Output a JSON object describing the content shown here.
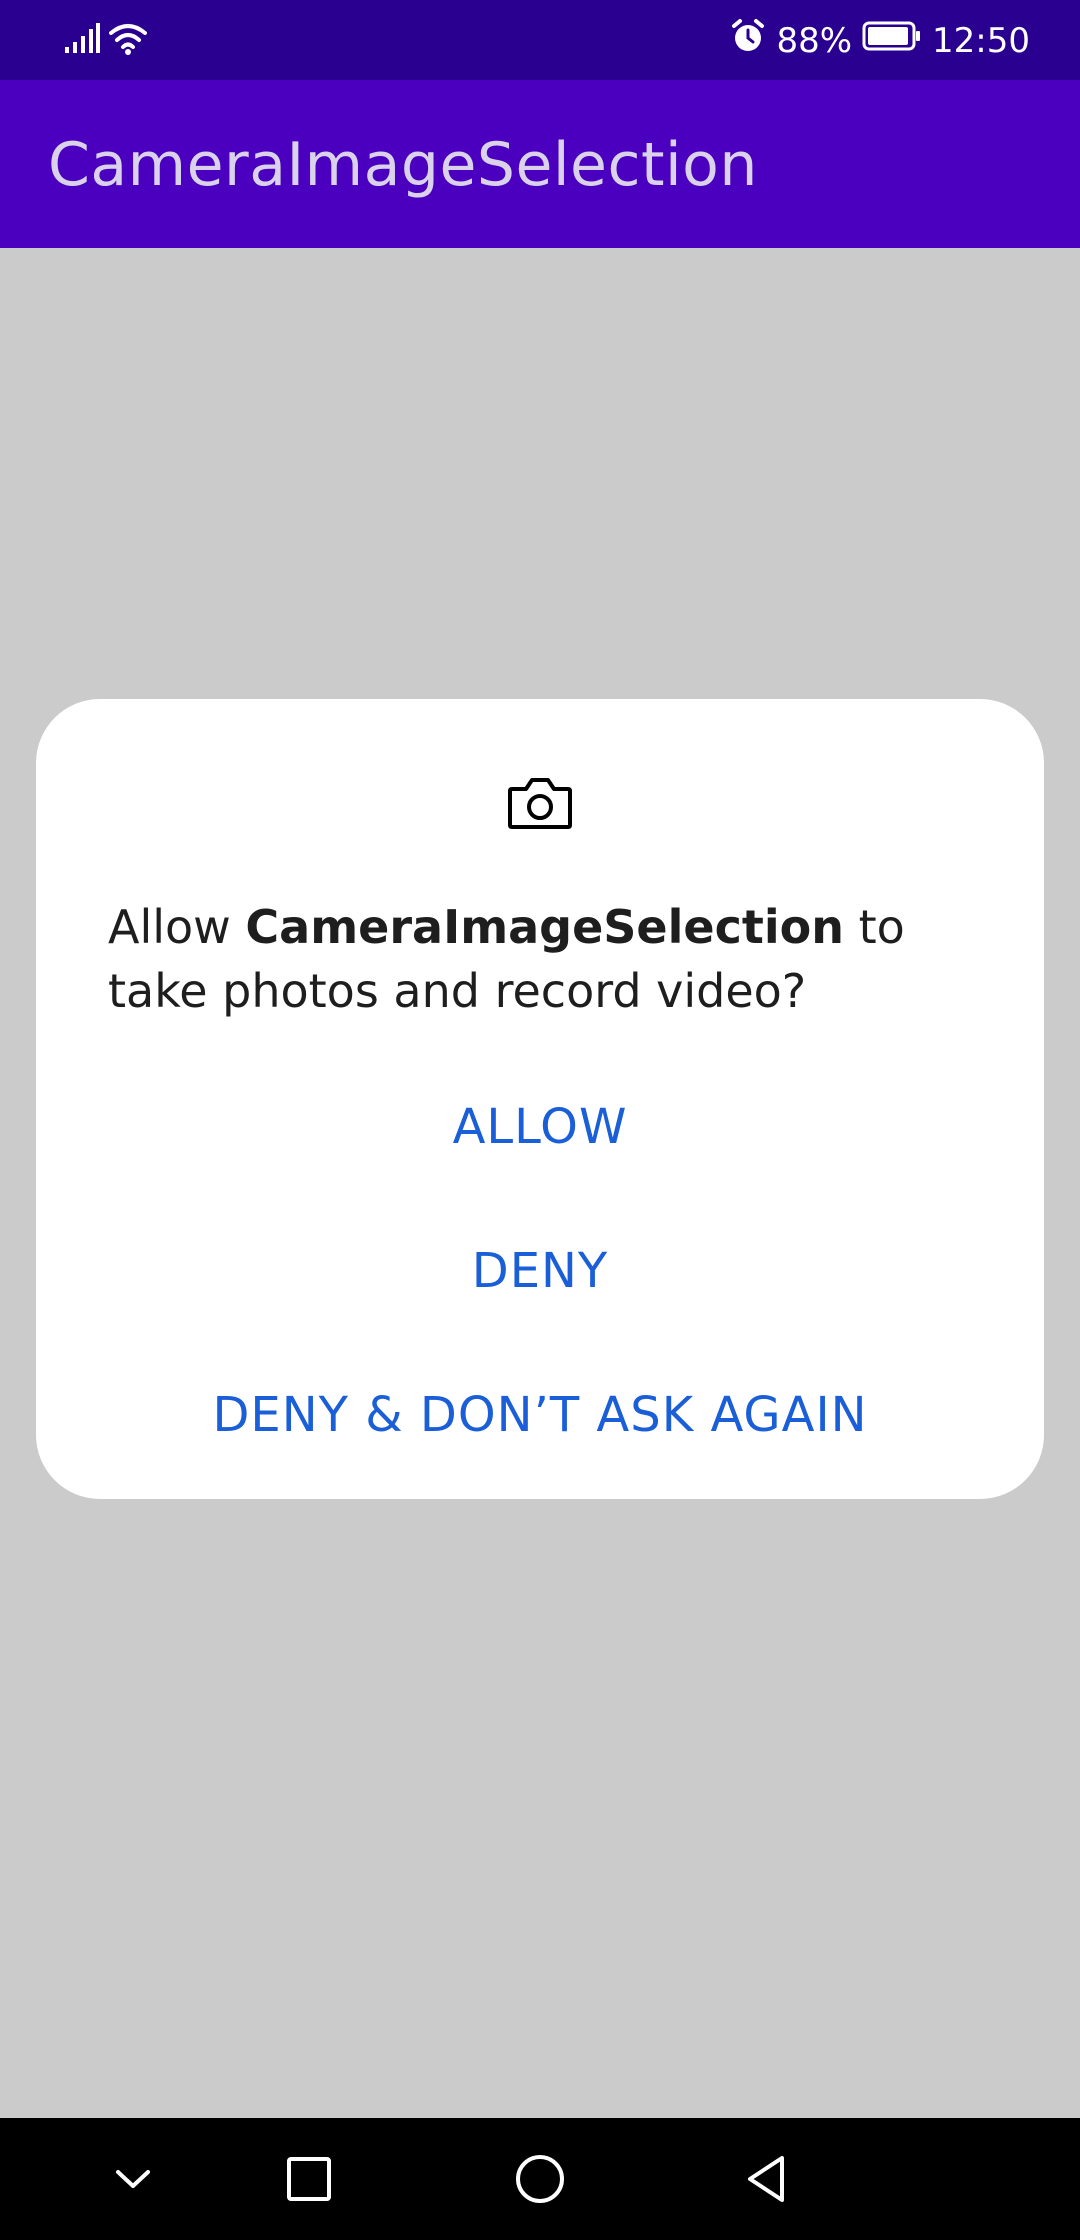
{
  "status_bar": {
    "battery": "88%",
    "time": "12:50",
    "icons": [
      "signal-icon",
      "wifi-icon",
      "alarm-icon",
      "battery-icon"
    ]
  },
  "app_bar": {
    "title": "CameraImageSelection"
  },
  "dialog": {
    "icon": "camera-icon",
    "message": {
      "prefix": "Allow ",
      "app_name": "CameraImageSelection",
      "suffix": " to take photos and record video?"
    },
    "buttons": {
      "allow": "ALLOW",
      "deny": "DENY",
      "deny_never": "DENY & DON’T ASK AGAIN"
    }
  },
  "nav_bar": {
    "icons": [
      "down-chevron-icon",
      "recent-apps-icon",
      "home-icon",
      "back-icon"
    ]
  },
  "colors": {
    "status_bar": "#2a0091",
    "app_bar": "#4b00c0",
    "background": "#cbcbcb",
    "button_text": "#1a5fd8"
  }
}
